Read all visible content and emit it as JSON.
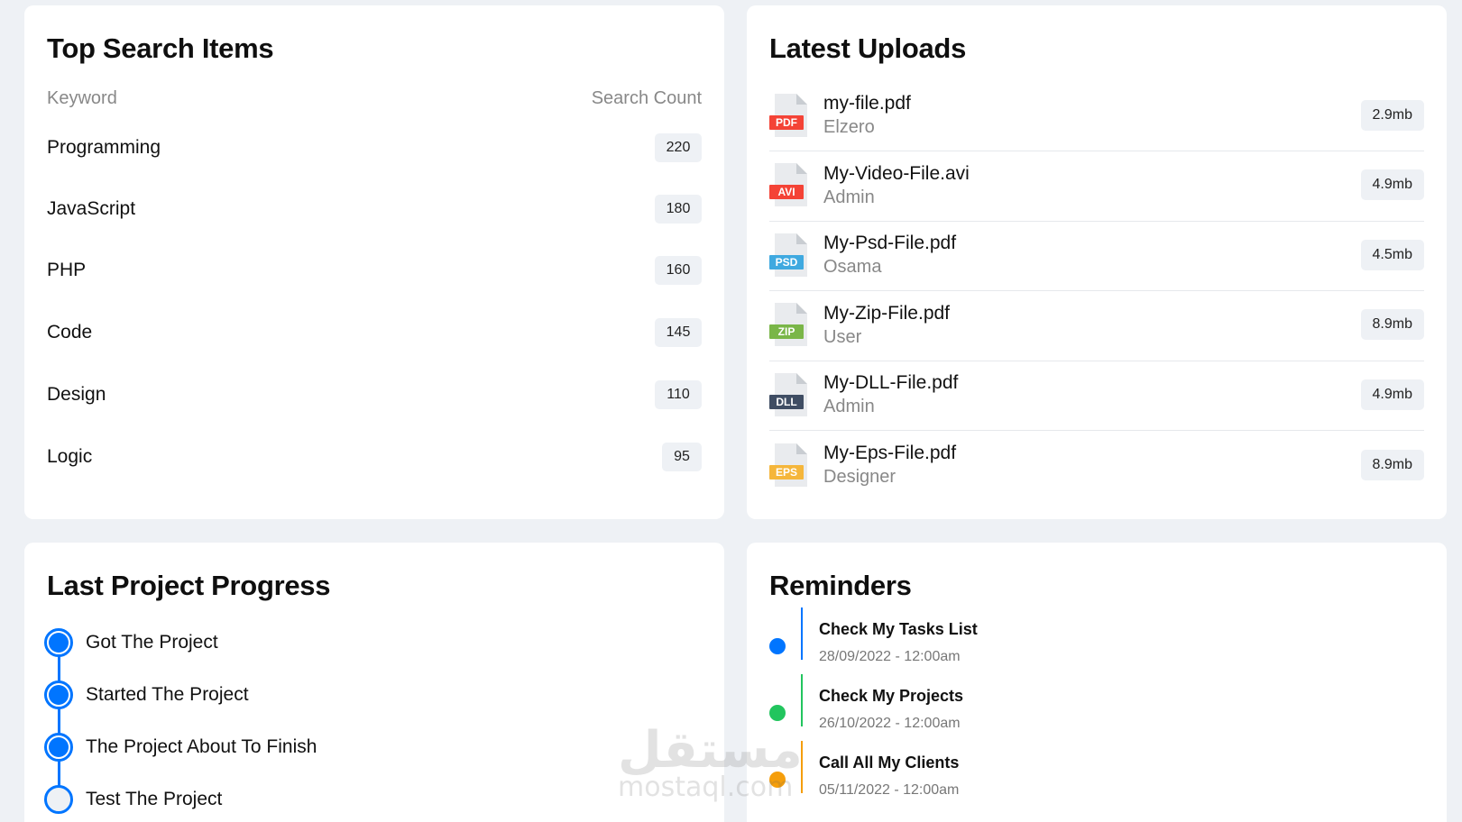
{
  "top_search": {
    "title": "Top Search Items",
    "col_keyword": "Keyword",
    "col_count": "Search Count",
    "rows": [
      {
        "keyword": "Programming",
        "count": "220"
      },
      {
        "keyword": "JavaScript",
        "count": "180"
      },
      {
        "keyword": "PHP",
        "count": "160"
      },
      {
        "keyword": "Code",
        "count": "145"
      },
      {
        "keyword": "Design",
        "count": "110"
      },
      {
        "keyword": "Logic",
        "count": "95"
      }
    ]
  },
  "latest_uploads": {
    "title": "Latest Uploads",
    "files": [
      {
        "name": "my-file.pdf",
        "user": "Elzero",
        "size": "2.9mb",
        "tag": "PDF",
        "tag_color": "#f44336",
        "icon": "file-pdf-icon"
      },
      {
        "name": "My-Video-File.avi",
        "user": "Admin",
        "size": "4.9mb",
        "tag": "AVI",
        "tag_color": "#f44336",
        "icon": "file-avi-icon"
      },
      {
        "name": "My-Psd-File.pdf",
        "user": "Osama",
        "size": "4.5mb",
        "tag": "PSD",
        "tag_color": "#3fa9e0",
        "icon": "file-psd-icon"
      },
      {
        "name": "My-Zip-File.pdf",
        "user": "User",
        "size": "8.9mb",
        "tag": "ZIP",
        "tag_color": "#7ab648",
        "icon": "file-zip-icon"
      },
      {
        "name": "My-DLL-File.pdf",
        "user": "Admin",
        "size": "4.9mb",
        "tag": "DLL",
        "tag_color": "#3f4d63",
        "icon": "file-dll-icon"
      },
      {
        "name": "My-Eps-File.pdf",
        "user": "Designer",
        "size": "8.9mb",
        "tag": "EPS",
        "tag_color": "#f5b63b",
        "icon": "file-eps-icon"
      }
    ]
  },
  "project_progress": {
    "title": "Last Project Progress",
    "accent": "#0075ff",
    "steps": [
      {
        "label": "Got The Project",
        "done": true
      },
      {
        "label": "Started The Project",
        "done": true
      },
      {
        "label": "The Project About To Finish",
        "done": true
      },
      {
        "label": "Test The Project",
        "done": false
      }
    ]
  },
  "reminders": {
    "title": "Reminders",
    "items": [
      {
        "title": "Check My Tasks List",
        "date": "28/09/2022 - 12:00am",
        "color": "#0075ff"
      },
      {
        "title": "Check My Projects",
        "date": "26/10/2022 - 12:00am",
        "color": "#22c55e"
      },
      {
        "title": "Call All My Clients",
        "date": "05/11/2022 - 12:00am",
        "color": "#f59e0b"
      }
    ]
  },
  "watermark": {
    "arabic": "مستقل",
    "latin": "mostaql.com"
  }
}
